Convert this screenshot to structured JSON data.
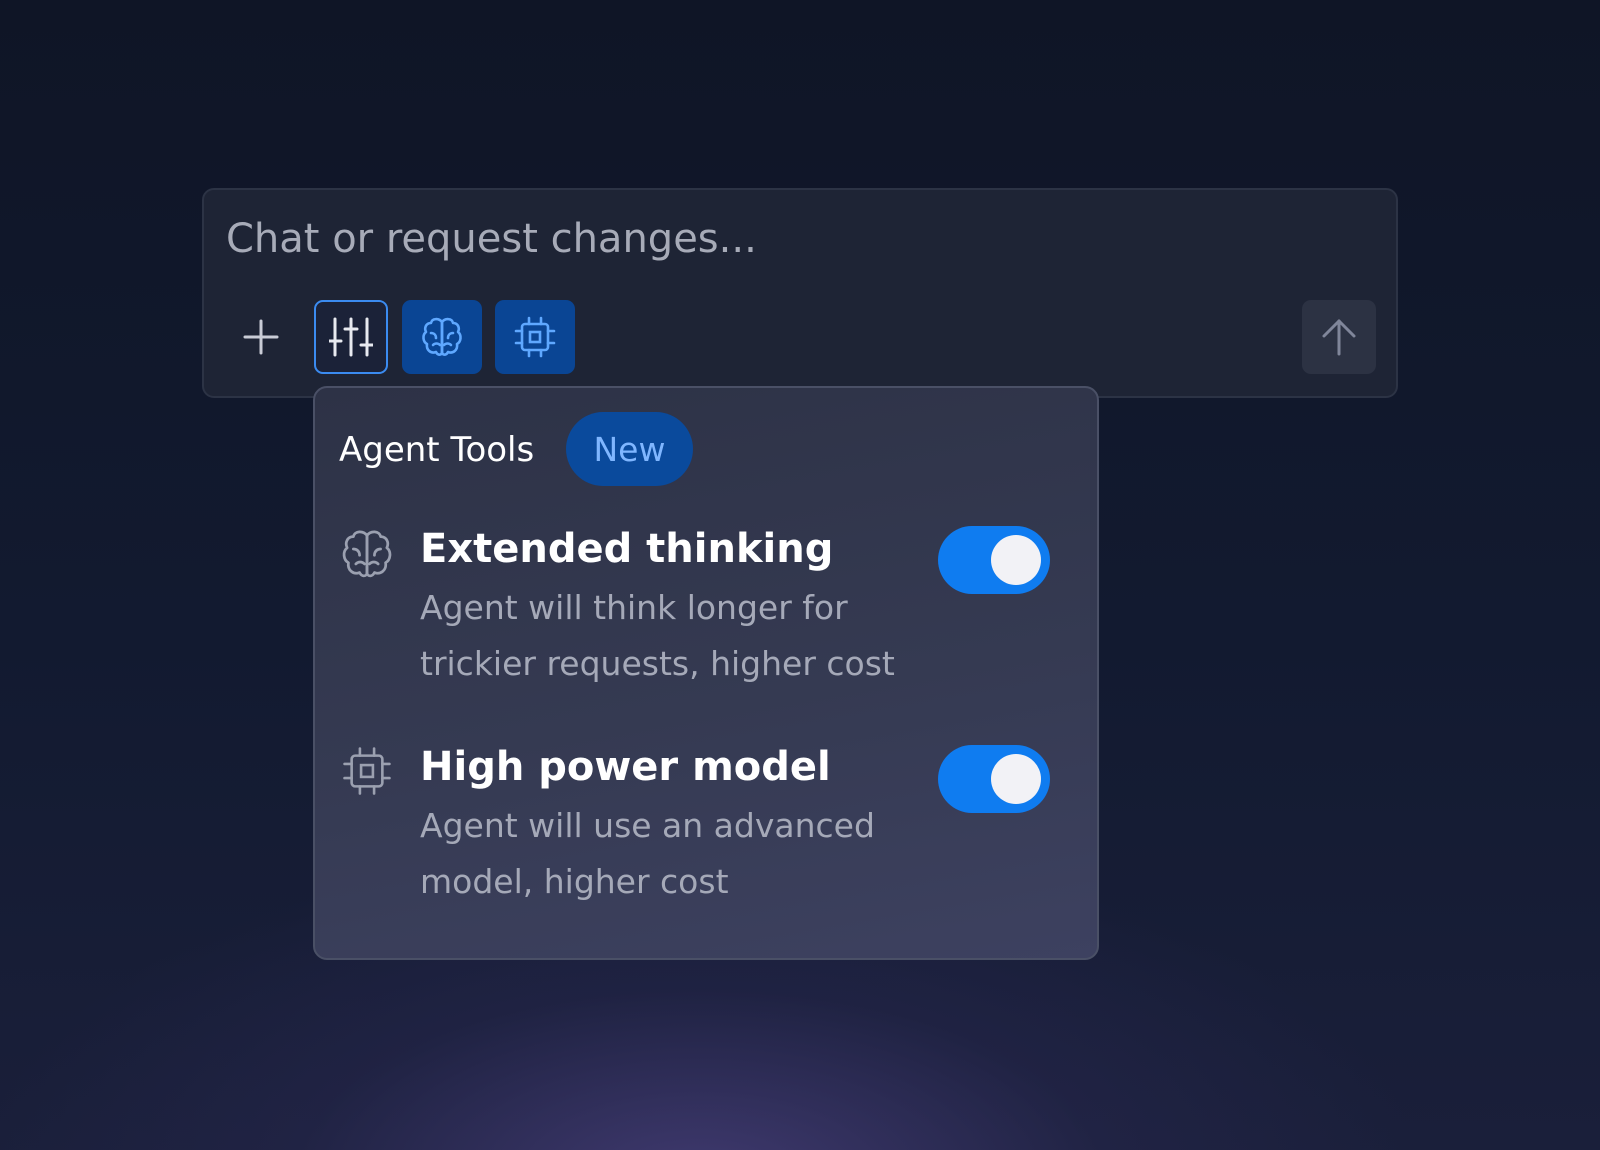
{
  "composer": {
    "placeholder": "Chat or request changes...",
    "buttons": {
      "add_icon": "plus-icon",
      "settings_icon": "sliders-icon",
      "brain_icon": "brain-icon",
      "chip_icon": "chip-icon",
      "send_icon": "arrow-up-icon"
    }
  },
  "agent_tools": {
    "title": "Agent Tools",
    "badge": "New",
    "options": [
      {
        "icon": "brain-icon",
        "title": "Extended thinking",
        "description": "Agent will think longer for trickier requests, higher cost",
        "enabled": true
      },
      {
        "icon": "chip-icon",
        "title": "High power model",
        "description": "Agent will use an advanced model, higher cost",
        "enabled": true
      }
    ]
  },
  "colors": {
    "accent": "#0f7cf0",
    "active_tool_bg": "#0a4594",
    "badge_text": "#7fb6ff"
  }
}
